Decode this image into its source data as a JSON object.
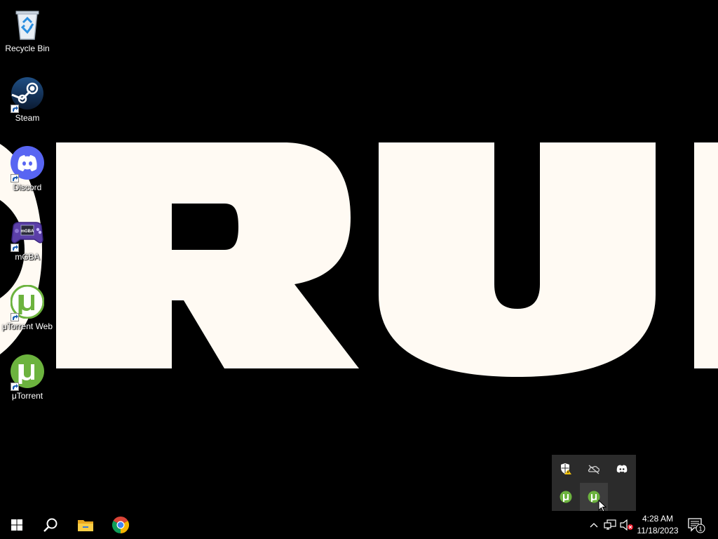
{
  "wallpaper": {
    "text": "RU"
  },
  "desktop": {
    "icons": [
      {
        "label": "Recycle Bin",
        "icon": "recycle-bin-icon"
      },
      {
        "label": "Steam",
        "icon": "steam-icon"
      },
      {
        "label": "Discord",
        "icon": "discord-icon"
      },
      {
        "label": "mGBA",
        "icon": "mgba-icon"
      },
      {
        "label": "μTorrent Web",
        "icon": "utorrent-web-icon"
      },
      {
        "label": "μTorrent",
        "icon": "utorrent-icon"
      }
    ]
  },
  "tray_flyout": {
    "items": [
      "windows-security-warning-icon",
      "onedrive-offline-icon",
      "discord-tray-icon",
      "utorrent-tray-icon",
      "utorrent-web-tray-icon"
    ]
  },
  "taskbar": {
    "pinned": [
      "start-icon",
      "search-icon",
      "file-explorer-icon",
      "chrome-icon"
    ],
    "clock": {
      "time": "4:28 AM",
      "date": "11/18/2023"
    },
    "notification_count": "1"
  },
  "colors": {
    "wallpaper_text": "#fffaf3",
    "discord": "#5865f2",
    "utorrent": "#6cb33e",
    "steam": "#1b2838",
    "mgba": "#5b3fa8"
  }
}
